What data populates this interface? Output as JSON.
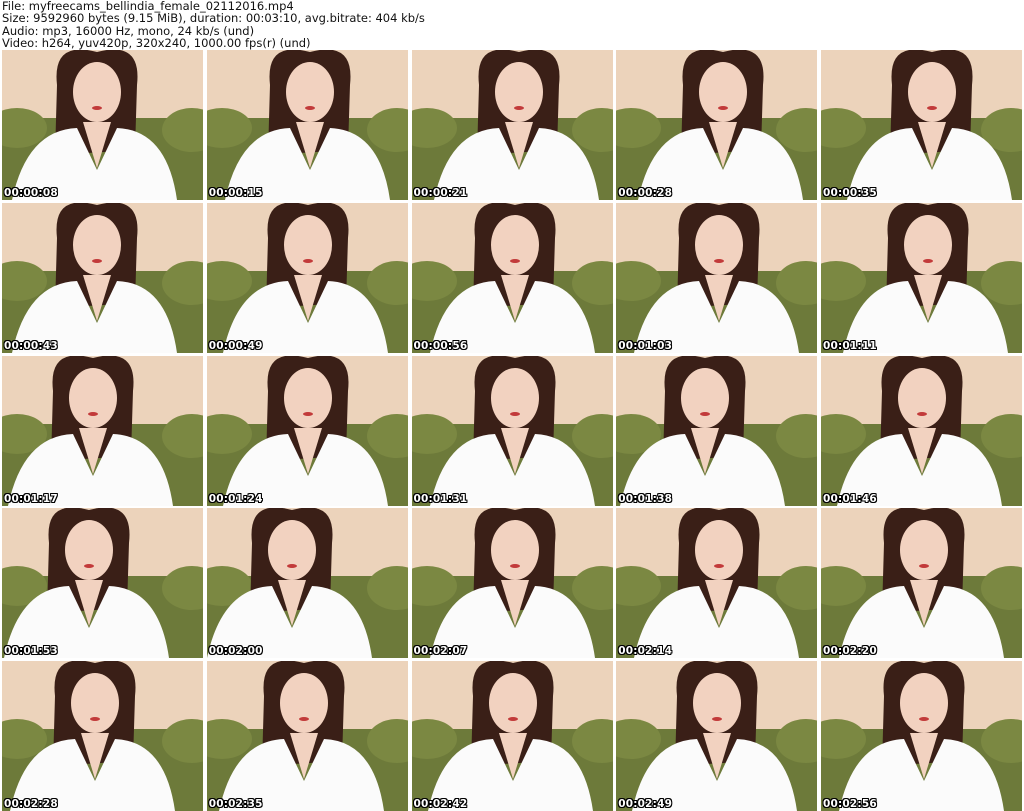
{
  "header": {
    "file_line": "File: myfreecams_bellindia_female_02112016.mp4",
    "size_line": "Size: 9592960 bytes (9.15 MiB), duration: 00:03:10, avg.bitrate: 404 kb/s",
    "audio_line": "Audio: mp3, 16000 Hz, mono, 24 kb/s (und)",
    "video_line": "Video: h264, yuv420p, 320x240, 1000.00 fps(r) (und)"
  },
  "thumbnails": [
    {
      "timestamp": "00:00:08"
    },
    {
      "timestamp": "00:00:15"
    },
    {
      "timestamp": "00:00:21"
    },
    {
      "timestamp": "00:00:28"
    },
    {
      "timestamp": "00:00:35"
    },
    {
      "timestamp": "00:00:43"
    },
    {
      "timestamp": "00:00:49"
    },
    {
      "timestamp": "00:00:56"
    },
    {
      "timestamp": "00:01:03"
    },
    {
      "timestamp": "00:01:11"
    },
    {
      "timestamp": "00:01:17"
    },
    {
      "timestamp": "00:01:24"
    },
    {
      "timestamp": "00:01:31"
    },
    {
      "timestamp": "00:01:38"
    },
    {
      "timestamp": "00:01:46"
    },
    {
      "timestamp": "00:01:53"
    },
    {
      "timestamp": "00:02:00"
    },
    {
      "timestamp": "00:02:07"
    },
    {
      "timestamp": "00:02:14"
    },
    {
      "timestamp": "00:02:20"
    },
    {
      "timestamp": "00:02:28"
    },
    {
      "timestamp": "00:02:35"
    },
    {
      "timestamp": "00:02:42"
    },
    {
      "timestamp": "00:02:49"
    },
    {
      "timestamp": "00:02:56"
    }
  ],
  "colors": {
    "wall": "#ecd3bb",
    "sofa": "#6d7a3a",
    "hair": "#3a1f17",
    "skin": "#f2d2c0",
    "shirt": "#fbfbfb",
    "timestamp_text": "#ffffff"
  }
}
